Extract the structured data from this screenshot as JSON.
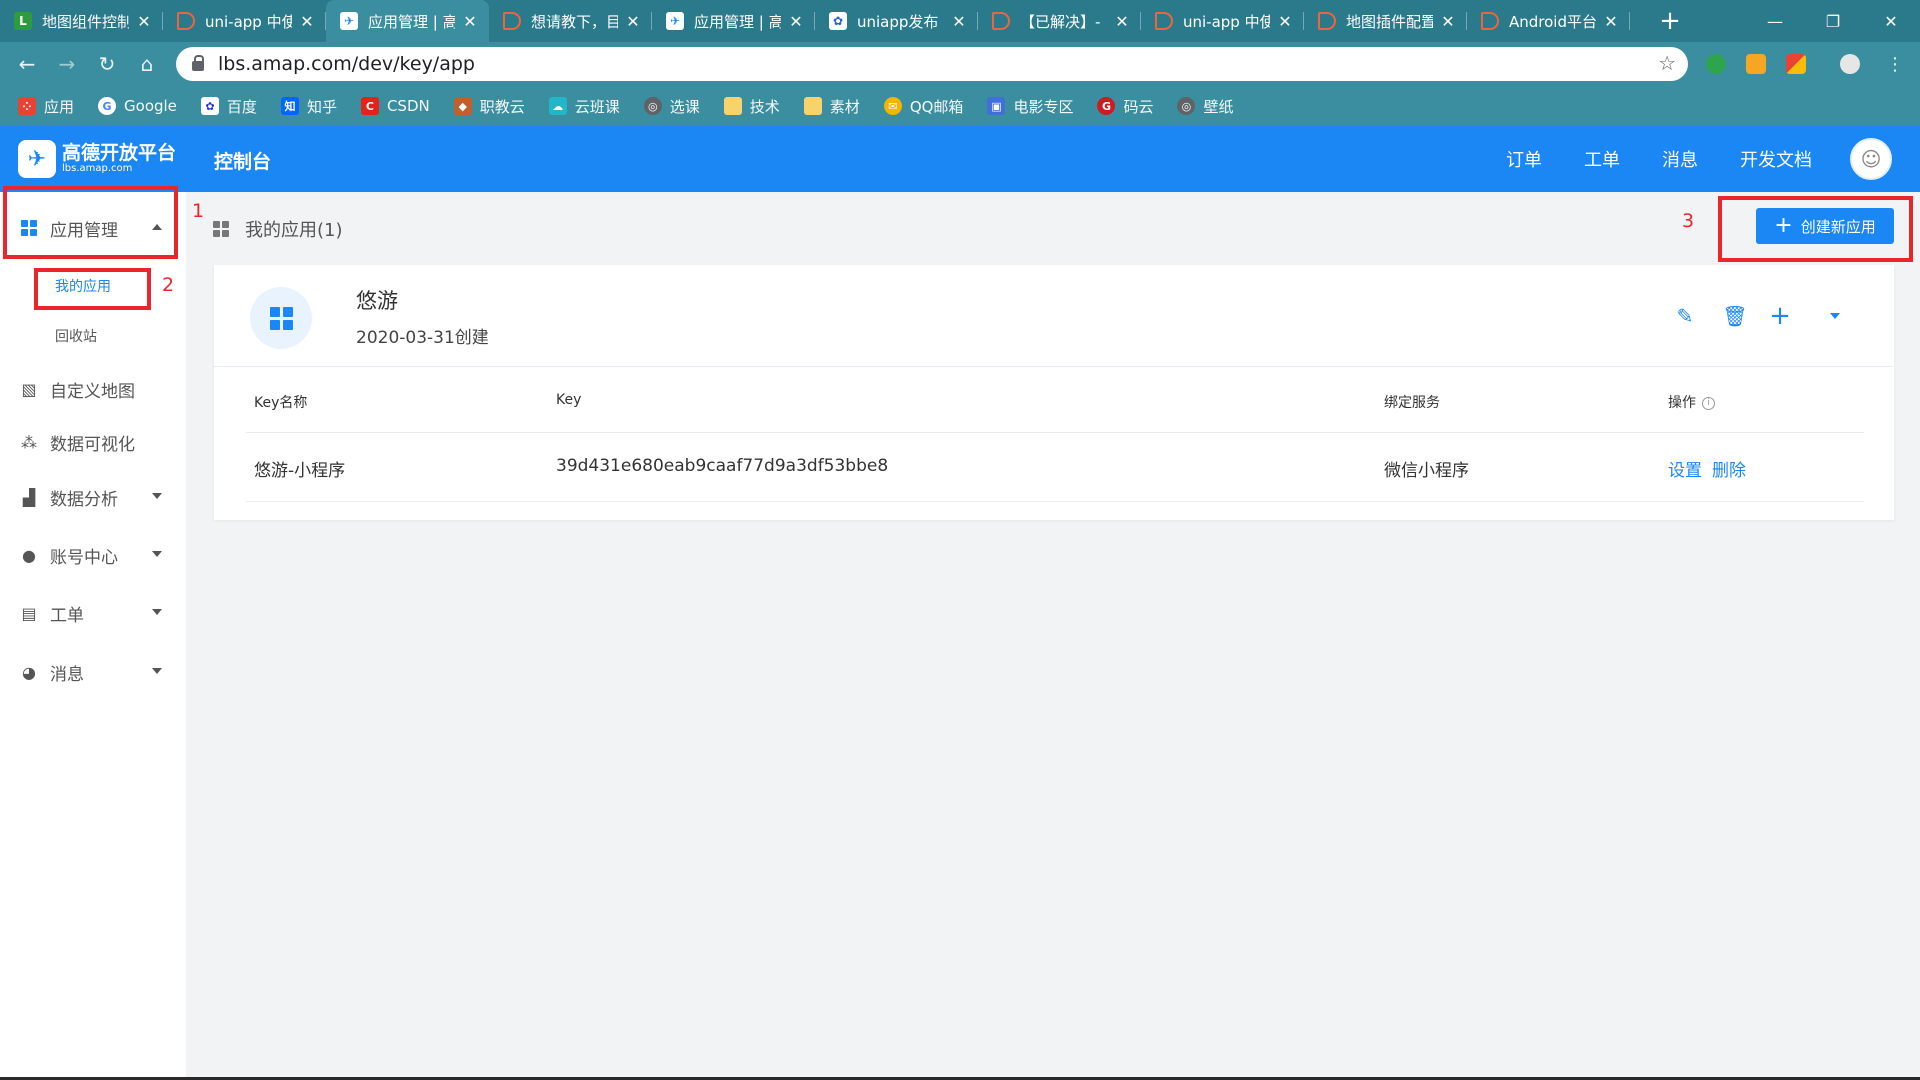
{
  "browser": {
    "tabs": [
      {
        "title": "地图组件控制",
        "favicon": "lu-icon"
      },
      {
        "title": "uni-app 中使",
        "favicon": "d-icon"
      },
      {
        "title": "应用管理 | 高",
        "favicon": "amap-icon"
      },
      {
        "title": "想请教下，目",
        "favicon": "d-icon"
      },
      {
        "title": "应用管理 | 高",
        "favicon": "amap-icon"
      },
      {
        "title": "uniapp发布",
        "favicon": "paw-icon"
      },
      {
        "title": "【已解决】-",
        "favicon": "d-icon"
      },
      {
        "title": "uni-app 中使",
        "favicon": "d-icon"
      },
      {
        "title": "地图插件配置",
        "favicon": "d-icon"
      },
      {
        "title": "Android平台",
        "favicon": "d-icon"
      }
    ],
    "active_tab_index": 2,
    "close_glyph": "✕",
    "new_tab_glyph": "+",
    "window_controls": {
      "minimize": "—",
      "restore": "❐",
      "close": "✕"
    },
    "url": "lbs.amap.com/dev/key/app",
    "bookmarks": [
      {
        "label": "应用",
        "icon": "apps-icon",
        "color": "#e94235"
      },
      {
        "label": "Google",
        "icon": "google-icon",
        "color": "#4285f4"
      },
      {
        "label": "百度",
        "icon": "baidu-icon",
        "color": "#2932e1"
      },
      {
        "label": "知乎",
        "icon": "zhihu-icon",
        "color": "#0066ff"
      },
      {
        "label": "CSDN",
        "icon": "csdn-icon",
        "color": "#e2231a"
      },
      {
        "label": "职教云",
        "icon": "zhijiaoyun-icon",
        "color": "#c0612b"
      },
      {
        "label": "云班课",
        "icon": "yunbanke-icon",
        "color": "#21b6c8"
      },
      {
        "label": "选课",
        "icon": "globe-icon",
        "color": "#5f6368"
      },
      {
        "label": "技术",
        "icon": "folder-icon",
        "color": "#f7d36c"
      },
      {
        "label": "素材",
        "icon": "folder-icon",
        "color": "#f7d36c"
      },
      {
        "label": "QQ邮箱",
        "icon": "qqmail-icon",
        "color": "#f5b400"
      },
      {
        "label": "电影专区",
        "icon": "movie-icon",
        "color": "#3f6fd8"
      },
      {
        "label": "码云",
        "icon": "gitee-icon",
        "color": "#c71d23"
      },
      {
        "label": "壁纸",
        "icon": "globe-icon",
        "color": "#5f6368"
      }
    ]
  },
  "header": {
    "logo_title": "高德开放平台",
    "logo_sub": "lbs.amap.com",
    "console": "控制台",
    "nav": [
      "订单",
      "工单",
      "消息",
      "开发文档"
    ],
    "brand_color": "#1b87f5"
  },
  "sidebar": {
    "app_management": "应用管理",
    "sub_items": [
      "我的应用",
      "回收站"
    ],
    "items": [
      "自定义地图",
      "数据可视化",
      "数据分析",
      "账号中心",
      "工单",
      "消息"
    ]
  },
  "main": {
    "title": "我的应用(1)",
    "create_button": "创建新应用",
    "app": {
      "name": "悠游",
      "created": "2020-03-31创建"
    },
    "table": {
      "headers": [
        "Key名称",
        "Key",
        "绑定服务",
        "操作"
      ],
      "info_glyph": "i",
      "rows": [
        {
          "name": "悠游-小程序",
          "key": "39d431e680eab9caaf77d9a3df53bbe8",
          "service": "微信小程序",
          "actions": [
            "设置",
            "删除"
          ]
        }
      ]
    }
  },
  "annotations": {
    "color": "#e8262c",
    "labels": [
      "1",
      "2",
      "3"
    ]
  }
}
